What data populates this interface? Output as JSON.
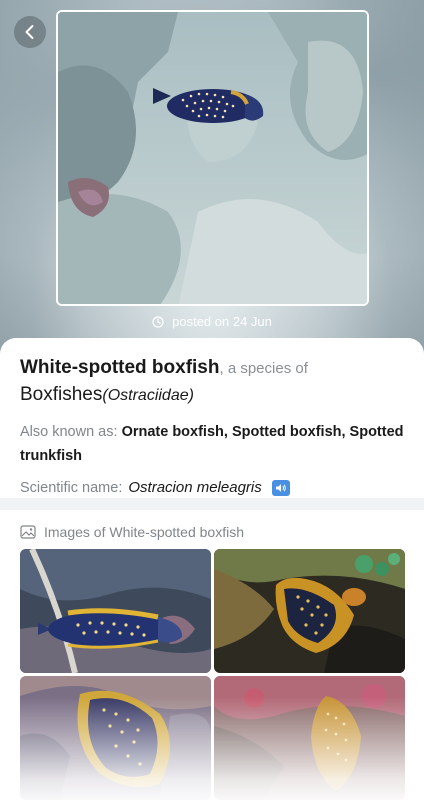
{
  "header": {
    "back_icon": "chevron-left-icon",
    "posted_label": "posted on 24 Jun",
    "clock_icon": "clock-icon"
  },
  "species": {
    "common_name": "White-spotted boxfish",
    "species_of": ", a species of",
    "family": "Boxfishes",
    "family_latin": "(Ostraciidae)",
    "aka_label": "Also known as:",
    "aka_names": "Ornate boxfish, Spotted boxfish, Spotted trunkfish",
    "scientific_label": "Scientific name:",
    "scientific_name": "Ostracion meleagris",
    "speaker_icon": "speaker-icon"
  },
  "images": {
    "heading": "Images of White-spotted boxfish",
    "heading_icon": "image-gallery-icon"
  },
  "colors": {
    "accent": "#4a90e2",
    "muted": "#80868b"
  }
}
